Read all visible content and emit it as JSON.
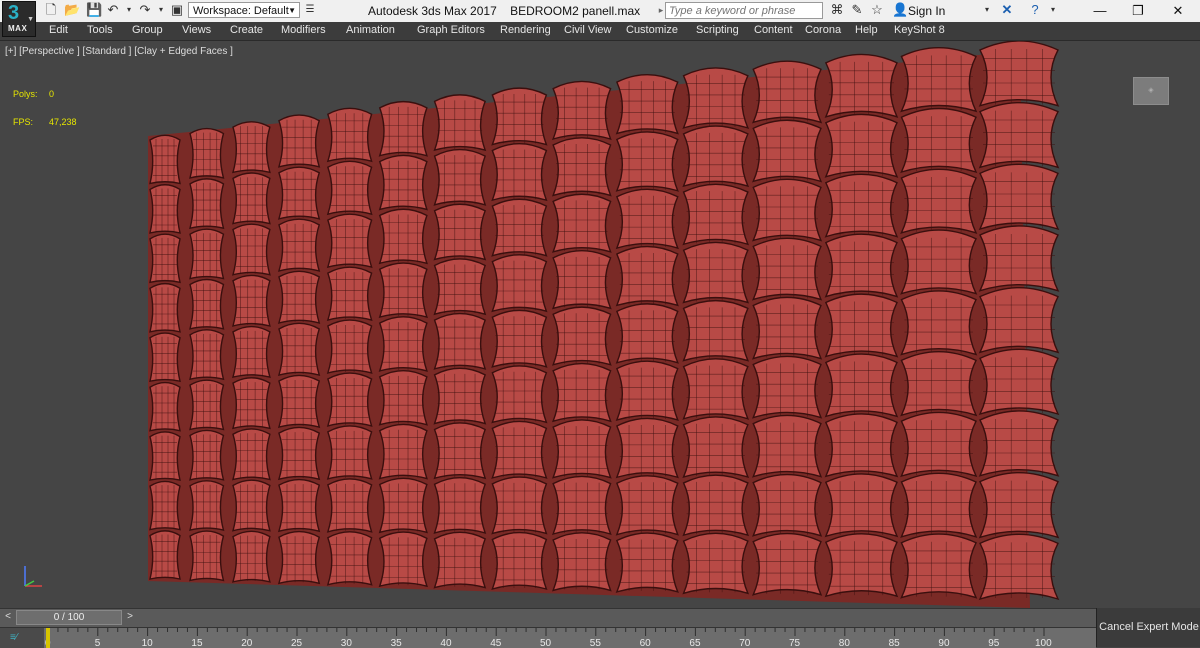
{
  "app": {
    "logo_number": "3",
    "logo_text": "MAX",
    "title": "Autodesk 3ds Max 2017",
    "file": "BEDROOM2 panell.max",
    "workspace": "Workspace: Default",
    "search_placeholder": "Type a keyword or phrase",
    "sign_in": "Sign In"
  },
  "menu": [
    "Edit",
    "Tools",
    "Group",
    "Views",
    "Create",
    "Modifiers",
    "Animation",
    "Graph Editors",
    "Rendering",
    "Civil View",
    "Customize",
    "Scripting",
    "Content",
    "Corona",
    "Help",
    "KeyShot 8"
  ],
  "viewport": {
    "label": "[+] [Perspective ] [Standard ] [Clay + Edged Faces ]",
    "stats": {
      "polys_label": "Polys:",
      "polys_value": "0",
      "fps_label": "FPS:",
      "fps_value": "47,238"
    },
    "tile_color": "#b84a46",
    "edge_color": "#3a0f0e"
  },
  "timeline": {
    "position": "0 / 100",
    "frame_current": 0,
    "frame_total": 100,
    "ticks": [
      "0",
      "5",
      "10",
      "15",
      "20",
      "25",
      "30",
      "35",
      "40",
      "45",
      "50",
      "55",
      "60",
      "65",
      "70",
      "75",
      "80",
      "85",
      "90",
      "95",
      "100"
    ],
    "cancel_label": "Cancel Expert Mode"
  },
  "icons": {
    "new": "new-file-icon",
    "open": "open-file-icon",
    "save": "save-icon",
    "undo": "undo-icon",
    "redo": "redo-icon",
    "project": "project-folder-icon",
    "binoculars": "binoculars-icon",
    "favorites": "star-icon",
    "user": "user-icon",
    "exchange": "autodesk-exchange-icon",
    "help": "help-icon"
  }
}
